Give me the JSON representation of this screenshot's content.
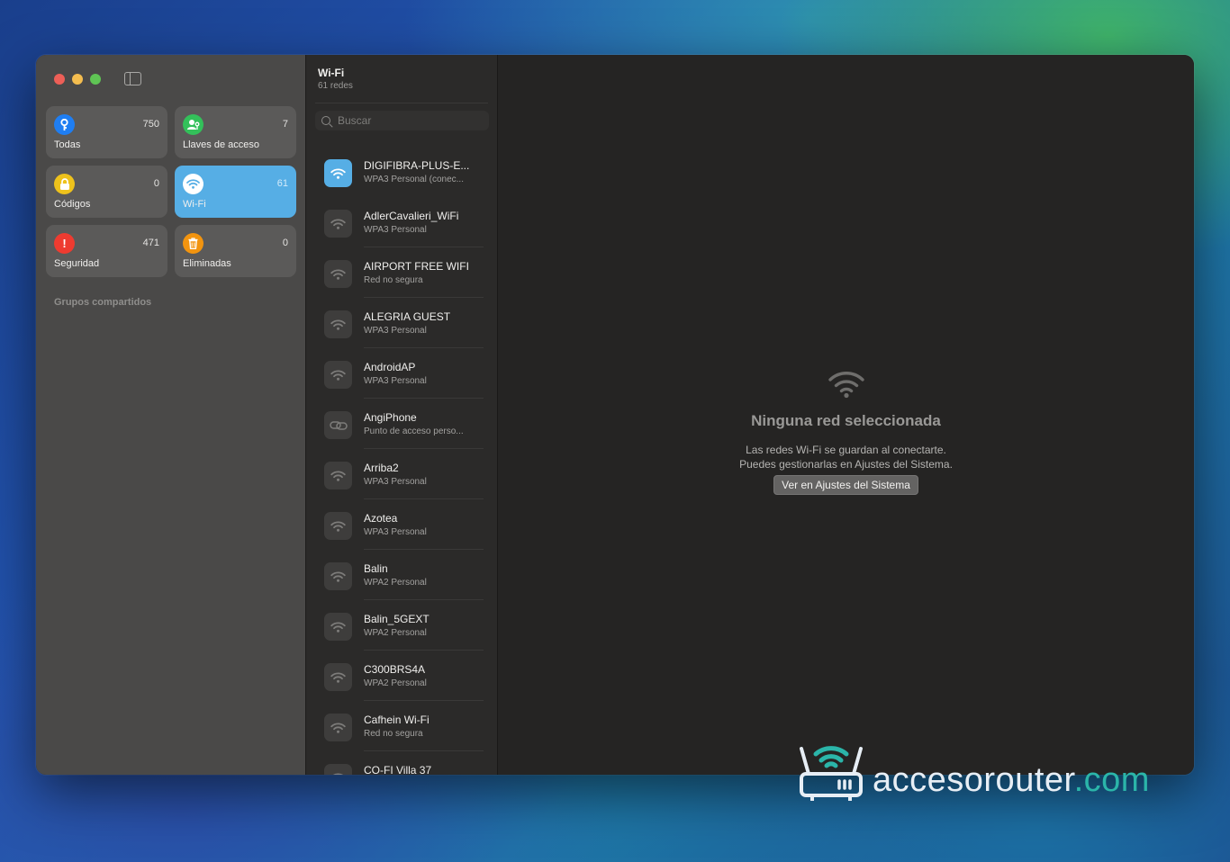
{
  "sidebar": {
    "tiles": [
      {
        "label": "Todas",
        "count": "750",
        "icon": "key-icon",
        "color": "#1f7ef2",
        "glyph": "⚿"
      },
      {
        "label": "Llaves de acceso",
        "count": "7",
        "icon": "person-key-icon",
        "color": "#33c05a",
        "glyph": "☺"
      },
      {
        "label": "Códigos",
        "count": "0",
        "icon": "lock-code-icon",
        "color": "#eec21c",
        "glyph": "🔒"
      },
      {
        "label": "Wi-Fi",
        "count": "61",
        "icon": "wifi-icon",
        "color": "#ffffff",
        "glyph": ""
      },
      {
        "label": "Seguridad",
        "count": "471",
        "icon": "exclamation-icon",
        "color": "#ee3b30",
        "glyph": "!"
      },
      {
        "label": "Eliminadas",
        "count": "0",
        "icon": "trash-icon",
        "color": "#f2940f",
        "glyph": "🗑"
      }
    ],
    "section_label": "Grupos compartidos"
  },
  "list": {
    "title": "Wi-Fi",
    "subtitle": "61 redes",
    "search_placeholder": "Buscar",
    "networks": [
      {
        "name": "DIGIFIBRA-PLUS-E...",
        "security": "WPA3 Personal (conec...",
        "icon": "wifi-icon",
        "selected": true
      },
      {
        "name": "AdlerCavalieri_WiFi",
        "security": "WPA3 Personal",
        "icon": "wifi-icon"
      },
      {
        "name": "AIRPORT FREE WIFI",
        "security": "Red no segura",
        "icon": "wifi-icon"
      },
      {
        "name": "ALEGRIA GUEST",
        "security": "WPA3 Personal",
        "icon": "wifi-icon"
      },
      {
        "name": "AndroidAP",
        "security": "WPA3 Personal",
        "icon": "wifi-icon"
      },
      {
        "name": "AngiPhone",
        "security": "Punto de acceso perso...",
        "icon": "hotspot-link-icon"
      },
      {
        "name": "Arriba2",
        "security": "WPA3 Personal",
        "icon": "wifi-icon"
      },
      {
        "name": "Azotea",
        "security": "WPA3 Personal",
        "icon": "wifi-icon"
      },
      {
        "name": "Balin",
        "security": "WPA2 Personal",
        "icon": "wifi-icon"
      },
      {
        "name": "Balin_5GEXT",
        "security": "WPA2 Personal",
        "icon": "wifi-icon"
      },
      {
        "name": "C300BRS4A",
        "security": "WPA2 Personal",
        "icon": "wifi-icon"
      },
      {
        "name": "Cafhein Wi-Fi",
        "security": "Red no segura",
        "icon": "wifi-icon"
      },
      {
        "name": "CO-FI Villa 37",
        "security": "",
        "icon": "wifi-icon"
      }
    ]
  },
  "detail": {
    "title": "Ninguna red seleccionada",
    "desc_line1": "Las redes Wi-Fi se guardan al conectarte.",
    "desc_line2": "Puedes gestionarlas en Ajustes del Sistema.",
    "button": "Ver en Ajustes del Sistema"
  },
  "watermark": {
    "name": "accesorouter",
    "tld": ".com"
  },
  "colors": {
    "accent": "#56aee5",
    "watermark_teal": "#2bb5a9"
  }
}
